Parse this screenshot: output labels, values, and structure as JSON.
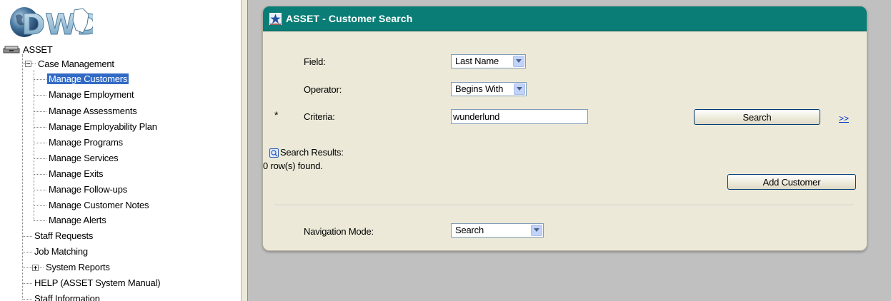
{
  "nav": {
    "logo_text": "DWD",
    "root": {
      "label": "ASSET",
      "icon": "asset-drawer-icon"
    },
    "case_management": {
      "label": "Case Management",
      "expander": "collapse",
      "children": [
        {
          "label": "Manage Customers",
          "selected": true
        },
        {
          "label": "Manage Employment"
        },
        {
          "label": "Manage Assessments"
        },
        {
          "label": "Manage Employability Plan"
        },
        {
          "label": "Manage Programs"
        },
        {
          "label": "Manage Services"
        },
        {
          "label": "Manage Exits"
        },
        {
          "label": "Manage Follow-ups"
        },
        {
          "label": "Manage Customer Notes"
        },
        {
          "label": "Manage Alerts"
        }
      ]
    },
    "items": [
      {
        "label": "Staff Requests"
      },
      {
        "label": "Job Matching"
      },
      {
        "label": "System Reports",
        "expander": "expand"
      },
      {
        "label": "HELP (ASSET System Manual)"
      },
      {
        "label": "Staff Information"
      }
    ]
  },
  "panel": {
    "title": "ASSET - Customer Search",
    "title_icon": "asset-star-icon",
    "header_color": "#0a7d76",
    "field": {
      "label": "Field:",
      "value": "Last Name"
    },
    "operator": {
      "label": "Operator:",
      "value": "Begins With"
    },
    "criteria": {
      "required_mark": "*",
      "label": "Criteria:",
      "value": "wunderlund"
    },
    "search_button": "Search",
    "more_link": ">>",
    "results": {
      "label": "Search Results:",
      "count_text": "0 row(s) found."
    },
    "add_customer_button": "Add Customer",
    "navigation_mode": {
      "label": "Navigation Mode:",
      "value": "Search"
    }
  },
  "colors": {
    "selected_bg": "#316ac5",
    "link": "#0033cc",
    "content_bg": "#c0c0c0",
    "panel_bg": "#ece9d8"
  }
}
